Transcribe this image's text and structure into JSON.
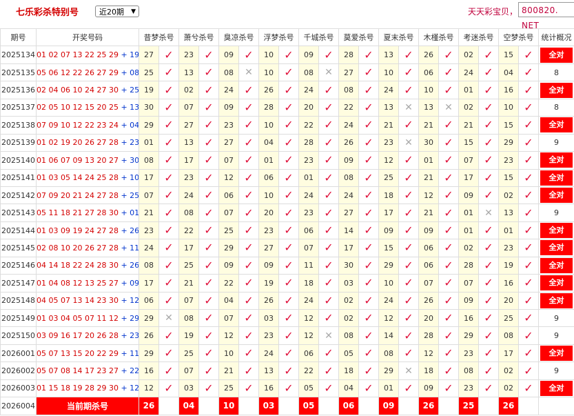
{
  "header": {
    "title": "七乐彩杀特别号",
    "period_select": "近20期",
    "site_name": "天天彩宝贝，",
    "site_url": "800820. NET"
  },
  "columns": [
    "期号",
    "开奖号码",
    "昔梦杀号",
    "萧兮杀号",
    "臭凉杀号",
    "浮梦杀号",
    "千城杀号",
    "莫爱杀号",
    "夏末杀号",
    "木槿杀号",
    "考迷杀号",
    "空梦杀号",
    "统计概况"
  ],
  "rows": [
    {
      "issue": "2025134",
      "nums": "01 02 07 13 22 25 29",
      "sp": "+ 19",
      "kills": [
        "27",
        "23",
        "09",
        "10",
        "09",
        "28",
        "13",
        "26",
        "02",
        "15"
      ],
      "ok": [
        1,
        1,
        1,
        1,
        1,
        1,
        1,
        1,
        1,
        1
      ],
      "stat": "全对",
      "all": true
    },
    {
      "issue": "2025135",
      "nums": "05 06 12 22 26 27 29",
      "sp": "+ 08",
      "kills": [
        "25",
        "13",
        "08",
        "10",
        "08",
        "27",
        "10",
        "06",
        "24",
        "04"
      ],
      "ok": [
        1,
        1,
        0,
        1,
        0,
        1,
        1,
        1,
        1,
        1
      ],
      "stat": "8",
      "all": false
    },
    {
      "issue": "2025136",
      "nums": "02 04 06 10 24 27 30",
      "sp": "+ 25",
      "kills": [
        "19",
        "02",
        "24",
        "26",
        "24",
        "08",
        "24",
        "10",
        "01",
        "16"
      ],
      "ok": [
        1,
        1,
        1,
        1,
        1,
        1,
        1,
        1,
        1,
        1
      ],
      "stat": "全对",
      "all": true
    },
    {
      "issue": "2025137",
      "nums": "02 05 10 12 15 20 25",
      "sp": "+ 13",
      "kills": [
        "30",
        "07",
        "09",
        "28",
        "20",
        "22",
        "13",
        "13",
        "02",
        "10"
      ],
      "ok": [
        1,
        1,
        1,
        1,
        1,
        1,
        0,
        0,
        1,
        1
      ],
      "stat": "8",
      "all": false
    },
    {
      "issue": "2025138",
      "nums": "07 09 10 12 22 23 24",
      "sp": "+ 04",
      "kills": [
        "29",
        "27",
        "23",
        "10",
        "22",
        "24",
        "21",
        "21",
        "21",
        "15"
      ],
      "ok": [
        1,
        1,
        1,
        1,
        1,
        1,
        1,
        1,
        1,
        1
      ],
      "stat": "全对",
      "all": true
    },
    {
      "issue": "2025139",
      "nums": "01 02 19 20 26 27 28",
      "sp": "+ 23",
      "kills": [
        "01",
        "13",
        "27",
        "04",
        "28",
        "26",
        "23",
        "30",
        "15",
        "29"
      ],
      "ok": [
        1,
        1,
        1,
        1,
        1,
        1,
        0,
        1,
        1,
        1
      ],
      "stat": "9",
      "all": false
    },
    {
      "issue": "2025140",
      "nums": "01 06 07 09 13 20 27",
      "sp": "+ 30",
      "kills": [
        "08",
        "17",
        "07",
        "01",
        "23",
        "09",
        "12",
        "01",
        "07",
        "23"
      ],
      "ok": [
        1,
        1,
        1,
        1,
        1,
        1,
        1,
        1,
        1,
        1
      ],
      "stat": "全对",
      "all": true
    },
    {
      "issue": "2025141",
      "nums": "01 03 05 14 24 25 28",
      "sp": "+ 10",
      "kills": [
        "17",
        "23",
        "12",
        "06",
        "01",
        "08",
        "25",
        "21",
        "17",
        "15"
      ],
      "ok": [
        1,
        1,
        1,
        1,
        1,
        1,
        1,
        1,
        1,
        1
      ],
      "stat": "全对",
      "all": true
    },
    {
      "issue": "2025142",
      "nums": "07 09 20 21 24 27 28",
      "sp": "+ 25",
      "kills": [
        "07",
        "24",
        "06",
        "10",
        "24",
        "24",
        "18",
        "12",
        "09",
        "02"
      ],
      "ok": [
        1,
        1,
        1,
        1,
        1,
        1,
        1,
        1,
        1,
        1
      ],
      "stat": "全对",
      "all": true
    },
    {
      "issue": "2025143",
      "nums": "05 11 18 21 27 28 30",
      "sp": "+ 01",
      "kills": [
        "21",
        "08",
        "07",
        "20",
        "23",
        "27",
        "17",
        "21",
        "01",
        "13"
      ],
      "ok": [
        1,
        1,
        1,
        1,
        1,
        1,
        1,
        1,
        0,
        1
      ],
      "stat": "9",
      "all": false
    },
    {
      "issue": "2025144",
      "nums": "01 03 09 19 24 27 28",
      "sp": "+ 26",
      "kills": [
        "23",
        "22",
        "25",
        "23",
        "06",
        "14",
        "09",
        "09",
        "01",
        "01"
      ],
      "ok": [
        1,
        1,
        1,
        1,
        1,
        1,
        1,
        1,
        1,
        1
      ],
      "stat": "全对",
      "all": true
    },
    {
      "issue": "2025145",
      "nums": "02 08 10 20 26 27 28",
      "sp": "+ 11",
      "kills": [
        "24",
        "17",
        "29",
        "27",
        "07",
        "17",
        "15",
        "06",
        "02",
        "23"
      ],
      "ok": [
        1,
        1,
        1,
        1,
        1,
        1,
        1,
        1,
        1,
        1
      ],
      "stat": "全对",
      "all": true
    },
    {
      "issue": "2025146",
      "nums": "04 14 18 22 24 28 30",
      "sp": "+ 26",
      "kills": [
        "08",
        "25",
        "09",
        "09",
        "11",
        "30",
        "29",
        "06",
        "28",
        "19"
      ],
      "ok": [
        1,
        1,
        1,
        1,
        1,
        1,
        1,
        1,
        1,
        1
      ],
      "stat": "全对",
      "all": true
    },
    {
      "issue": "2025147",
      "nums": "01 04 08 12 13 25 27",
      "sp": "+ 09",
      "kills": [
        "17",
        "21",
        "22",
        "19",
        "18",
        "03",
        "10",
        "07",
        "07",
        "16"
      ],
      "ok": [
        1,
        1,
        1,
        1,
        1,
        1,
        1,
        1,
        1,
        1
      ],
      "stat": "全对",
      "all": true
    },
    {
      "issue": "2025148",
      "nums": "04 05 07 13 14 23 30",
      "sp": "+ 12",
      "kills": [
        "06",
        "07",
        "04",
        "26",
        "24",
        "02",
        "24",
        "26",
        "09",
        "20"
      ],
      "ok": [
        1,
        1,
        1,
        1,
        1,
        1,
        1,
        1,
        1,
        1
      ],
      "stat": "全对",
      "all": true
    },
    {
      "issue": "2025149",
      "nums": "01 03 04 05 07 11 12",
      "sp": "+ 29",
      "kills": [
        "29",
        "08",
        "07",
        "03",
        "12",
        "02",
        "12",
        "20",
        "16",
        "25"
      ],
      "ok": [
        0,
        1,
        1,
        1,
        1,
        1,
        1,
        1,
        1,
        1
      ],
      "stat": "9",
      "all": false
    },
    {
      "issue": "2025150",
      "nums": "03 09 16 17 20 26 28",
      "sp": "+ 23",
      "kills": [
        "26",
        "19",
        "12",
        "23",
        "12",
        "08",
        "14",
        "28",
        "29",
        "08"
      ],
      "ok": [
        1,
        1,
        1,
        1,
        0,
        1,
        1,
        1,
        1,
        1
      ],
      "stat": "9",
      "all": false
    },
    {
      "issue": "2026001",
      "nums": "05 07 13 15 20 22 29",
      "sp": "+ 11",
      "kills": [
        "29",
        "25",
        "10",
        "24",
        "06",
        "05",
        "08",
        "12",
        "23",
        "17"
      ],
      "ok": [
        1,
        1,
        1,
        1,
        1,
        1,
        1,
        1,
        1,
        1
      ],
      "stat": "全对",
      "all": true
    },
    {
      "issue": "2026002",
      "nums": "05 07 08 14 17 23 27",
      "sp": "+ 22",
      "kills": [
        "16",
        "07",
        "21",
        "13",
        "22",
        "18",
        "29",
        "18",
        "08",
        "02"
      ],
      "ok": [
        1,
        1,
        1,
        1,
        1,
        1,
        0,
        1,
        1,
        1
      ],
      "stat": "9",
      "all": false
    },
    {
      "issue": "2026003",
      "nums": "01 15 18 19 28 29 30",
      "sp": "+ 12",
      "kills": [
        "12",
        "03",
        "25",
        "16",
        "05",
        "04",
        "01",
        "09",
        "23",
        "02"
      ],
      "ok": [
        1,
        1,
        1,
        1,
        1,
        1,
        1,
        1,
        1,
        1
      ],
      "stat": "全对",
      "all": true
    }
  ],
  "current": {
    "issue": "2026004",
    "label": "当前期杀号",
    "kills": [
      "26",
      "04",
      "10",
      "03",
      "05",
      "06",
      "09",
      "26",
      "25",
      "26"
    ]
  },
  "marks": {
    "ok": "✓",
    "bad": "✕"
  }
}
